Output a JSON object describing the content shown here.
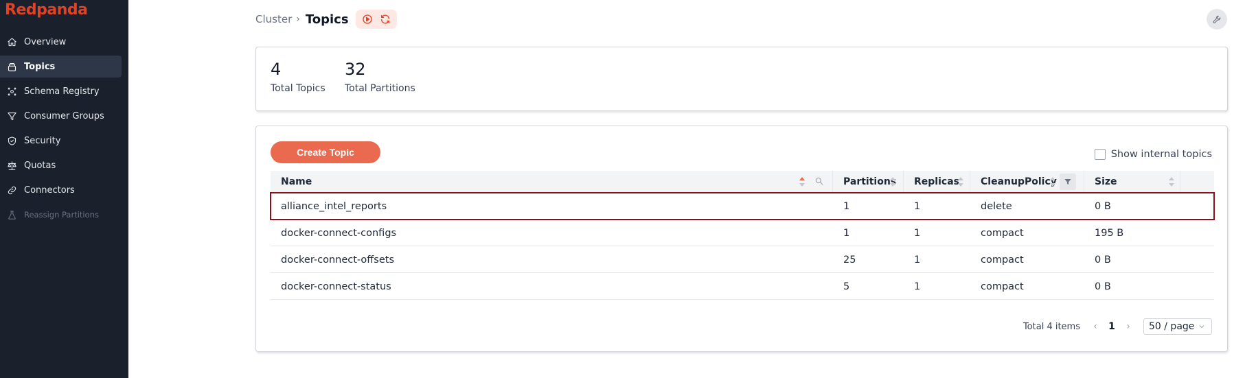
{
  "app": {
    "logo": "Redpanda",
    "accent": "#e14226"
  },
  "sidebar": {
    "items": [
      {
        "label": "Overview",
        "icon": "home-icon"
      },
      {
        "label": "Topics",
        "icon": "collection-icon",
        "active": true
      },
      {
        "label": "Schema Registry",
        "icon": "schema-icon"
      },
      {
        "label": "Consumer Groups",
        "icon": "funnel-icon"
      },
      {
        "label": "Security",
        "icon": "shield-icon"
      },
      {
        "label": "Quotas",
        "icon": "scale-icon"
      },
      {
        "label": "Connectors",
        "icon": "link-icon"
      },
      {
        "label": "Reassign Partitions",
        "icon": "beaker-icon",
        "disabled": true
      }
    ]
  },
  "header": {
    "breadcrumb": "Cluster",
    "title": "Topics"
  },
  "stats": {
    "total_topics": {
      "value": "4",
      "label": "Total Topics"
    },
    "total_partitions": {
      "value": "32",
      "label": "Total Partitions"
    }
  },
  "topics": {
    "create_button": "Create Topic",
    "show_internal_label": "Show internal topics",
    "show_internal_checked": false,
    "columns": [
      "Name",
      "Partitions",
      "Replicas",
      "CleanupPolicy",
      "Size"
    ],
    "rows": [
      {
        "name": "alliance_intel_reports",
        "partitions": "1",
        "replicas": "1",
        "cleanup": "delete",
        "size": "0 B"
      },
      {
        "name": "docker-connect-configs",
        "partitions": "1",
        "replicas": "1",
        "cleanup": "compact",
        "size": "195 B"
      },
      {
        "name": "docker-connect-offsets",
        "partitions": "25",
        "replicas": "1",
        "cleanup": "compact",
        "size": "0 B"
      },
      {
        "name": "docker-connect-status",
        "partitions": "5",
        "replicas": "1",
        "cleanup": "compact",
        "size": "0 B"
      }
    ],
    "highlight_color": "#8b0f1a",
    "pagination": {
      "total": "Total 4 items",
      "current_page": "1",
      "page_size": "50 / page"
    }
  }
}
